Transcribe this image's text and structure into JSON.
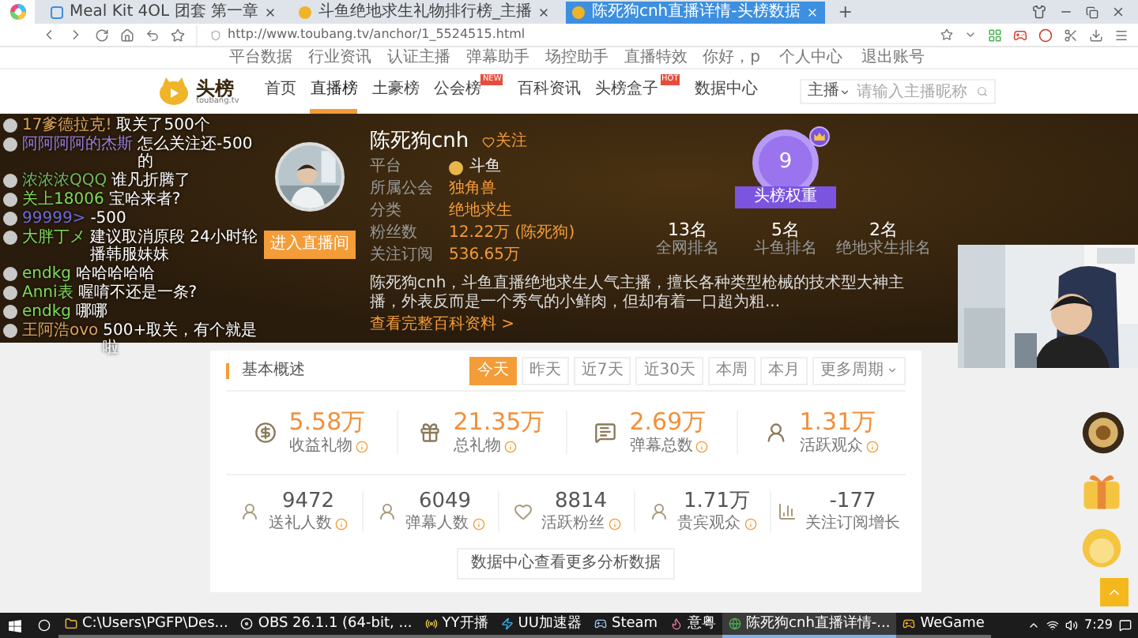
{
  "browser": {
    "tabs": [
      {
        "title": "Meal Kit 4OL 团套 第一章",
        "kind": "page",
        "selected": false
      },
      {
        "title": "斗鱼绝地求生礼物排行榜_主播",
        "kind": "toubang",
        "selected": false
      },
      {
        "title": "陈死狗cnh直播详情-头榜数据",
        "kind": "toubang",
        "selected": true
      }
    ],
    "new_tab": "+",
    "url": "http://www.toubang.tv/anchor/1_5524515.html"
  },
  "top_links": [
    "平台数据",
    "行业资讯",
    "认证主播",
    "弹幕助手",
    "场控助手",
    "直播特效"
  ],
  "user_links": [
    "你好，p",
    "个人中心",
    "退出账号"
  ],
  "logo": {
    "text": "头榜",
    "subtitle": "toubang.tv"
  },
  "nav": [
    {
      "label": "首页",
      "selected": false
    },
    {
      "label": "直播榜",
      "selected": true
    },
    {
      "label": "土豪榜",
      "selected": false
    },
    {
      "label": "公会榜",
      "selected": false,
      "badge": "NEW"
    },
    {
      "label": "百科资讯",
      "selected": false
    },
    {
      "label": "头榜盒子",
      "selected": false,
      "badge": "HOT"
    },
    {
      "label": "数据中心",
      "selected": false
    }
  ],
  "search": {
    "scope": "主播",
    "placeholder": "请输入主播昵称"
  },
  "chat": [
    {
      "name": "17爹德拉克!",
      "color": "#d9a25a",
      "message": "取关了500个"
    },
    {
      "name": "阿阿阿阿的杰斯",
      "color": "#9b7bd6",
      "message": "怎么关注还-500的"
    },
    {
      "name": "浓浓浓QQQ",
      "color": "#6fb65c",
      "message": "谁凡折腾了"
    },
    {
      "name": "关上18006",
      "color": "#7ed957",
      "message": "宝哈来者?"
    },
    {
      "name": "99999>",
      "color": "#6a6ad8",
      "message": "-500"
    },
    {
      "name": "大胖丁メ",
      "color": "#7ed957",
      "message": "建议取消原段 24小时轮播韩服妹妹"
    },
    {
      "name": "endkg",
      "color": "#7ed957",
      "message": "哈哈哈哈哈"
    },
    {
      "name": "Anni表",
      "color": "#7ed957",
      "message": "喔唷不还是一条?"
    },
    {
      "name": "endkg",
      "color": "#7ed957",
      "message": "哪哪"
    },
    {
      "name": "王阿浩ovo",
      "color": "#d9a25a",
      "message": "500+取关，有个就是啦"
    }
  ],
  "profile": {
    "name": "陈死狗cnh",
    "follow": "关注",
    "enter_button": "进入直播间",
    "fields": [
      {
        "label": "平台",
        "value": "斗鱼",
        "kind": "platform"
      },
      {
        "label": "所属公会",
        "value": "独角兽",
        "kind": "text"
      },
      {
        "label": "分类",
        "value": "绝地求生",
        "kind": "text"
      },
      {
        "label": "粉丝数",
        "value": "12.22万 (陈死狗)",
        "kind": "text"
      },
      {
        "label": "关注订阅",
        "value": "536.65万",
        "kind": "text"
      }
    ],
    "description": "陈死狗cnh，斗鱼直播绝地求生人气主播，擅长各种类型枪械的技术型大神主播，外表反而是一个秀气的小鲜肉，但却有着一口超为粗...",
    "more_link": "查看完整百科资料 >"
  },
  "weight": {
    "value": "9",
    "label": "头榜权重"
  },
  "ranks": [
    {
      "value": "13名",
      "label": "全网排名"
    },
    {
      "value": "5名",
      "label": "斗鱼排名"
    },
    {
      "value": "2名",
      "label": "绝地求生排名"
    }
  ],
  "overview": {
    "title": "基本概述",
    "periods": [
      {
        "label": "今天",
        "selected": true
      },
      {
        "label": "昨天",
        "selected": false
      },
      {
        "label": "近7天",
        "selected": false
      },
      {
        "label": "近30天",
        "selected": false
      },
      {
        "label": "本周",
        "selected": false
      },
      {
        "label": "本月",
        "selected": false
      }
    ],
    "more_periods": "更多周期",
    "stats_primary": [
      {
        "value": "5.58万",
        "label": "收益礼物",
        "kind": "coin"
      },
      {
        "value": "21.35万",
        "label": "总礼物",
        "kind": "gift"
      },
      {
        "value": "2.69万",
        "label": "弹幕总数",
        "kind": "comments"
      },
      {
        "value": "1.31万",
        "label": "活跃观众",
        "kind": "person"
      }
    ],
    "stats_secondary": [
      {
        "value": "9472",
        "label": "送礼人数",
        "kind": "person",
        "info": true
      },
      {
        "value": "6049",
        "label": "弹幕人数",
        "kind": "person",
        "info": true
      },
      {
        "value": "8814",
        "label": "活跃粉丝",
        "kind": "heart",
        "info": true
      },
      {
        "value": "1.71万",
        "label": "贵宾观众",
        "kind": "person",
        "info": true
      },
      {
        "value": "-177",
        "label": "关注订阅增长",
        "kind": "growth",
        "info": false
      }
    ],
    "more_button": "数据中心查看更多分析数据"
  },
  "taskbar": {
    "items": [
      {
        "label": "C:\\Users\\PGFP\\Des...",
        "kind": "folder",
        "selected": false
      },
      {
        "label": "OBS 26.1.1 (64-bit, ...",
        "kind": "obs",
        "selected": false
      },
      {
        "label": "YY开播",
        "kind": "yy",
        "selected": false
      },
      {
        "label": "UU加速器",
        "kind": "uu",
        "selected": false
      },
      {
        "label": "Steam",
        "kind": "steam",
        "selected": false
      },
      {
        "label": "意粤",
        "kind": "flame",
        "selected": false
      },
      {
        "label": "陈死狗cnh直播详情-...",
        "kind": "browser",
        "selected": true
      },
      {
        "label": "WeGame",
        "kind": "game",
        "selected": false
      }
    ],
    "time": "7:29"
  }
}
